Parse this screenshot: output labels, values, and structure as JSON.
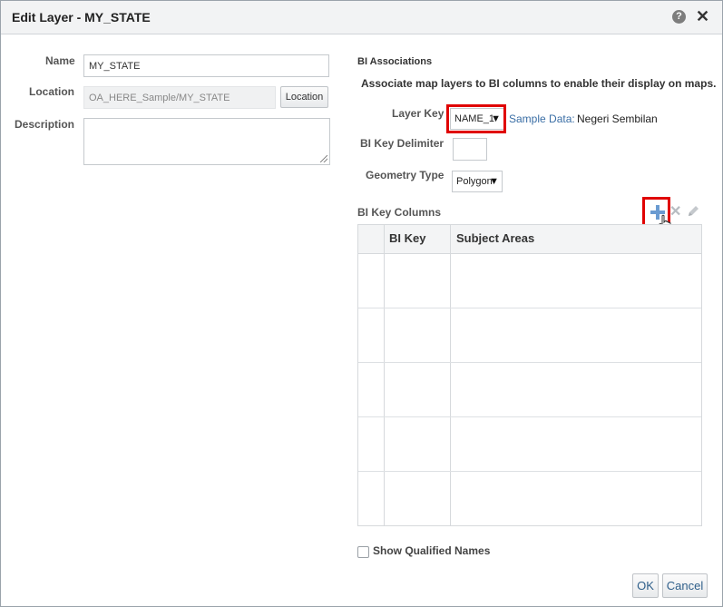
{
  "window": {
    "title": "Edit Layer - MY_STATE"
  },
  "left": {
    "name_label": "Name",
    "name_value": "MY_STATE",
    "location_label": "Location",
    "location_value": "OA_HERE_Sample/MY_STATE",
    "location_button": "Location",
    "description_label": "Description",
    "description_value": ""
  },
  "bi": {
    "section_title": "BI Associations",
    "description": "Associate map layers to BI columns to enable their display on maps.",
    "layer_key_label": "Layer Key",
    "layer_key_value": "NAME_1",
    "sample_data_label": "Sample Data:",
    "sample_data_value": "Negeri Sembilan",
    "delimiter_label": "BI Key Delimiter",
    "delimiter_value": "",
    "geometry_label": "Geometry Type",
    "geometry_value": "Polygon",
    "key_columns_title": "BI Key Columns",
    "columns": [
      "BI Key",
      "Subject Areas"
    ],
    "rows": [
      {
        "bi_key": "",
        "subject_areas": ""
      },
      {
        "bi_key": "",
        "subject_areas": ""
      },
      {
        "bi_key": "",
        "subject_areas": ""
      },
      {
        "bi_key": "",
        "subject_areas": ""
      },
      {
        "bi_key": "",
        "subject_areas": ""
      }
    ]
  },
  "footer": {
    "show_qualified_label": "Show Qualified Names",
    "show_qualified_checked": false,
    "ok_label": "OK",
    "cancel_label": "Cancel"
  },
  "colors": {
    "highlight": "#e00000",
    "link": "#3a6ea5",
    "add_icon": "#6a9bd1"
  },
  "icons": [
    "help-icon",
    "close-icon",
    "add-icon",
    "delete-icon",
    "edit-pencil-icon",
    "hand-cursor-icon",
    "dropdown-arrow-icon"
  ]
}
